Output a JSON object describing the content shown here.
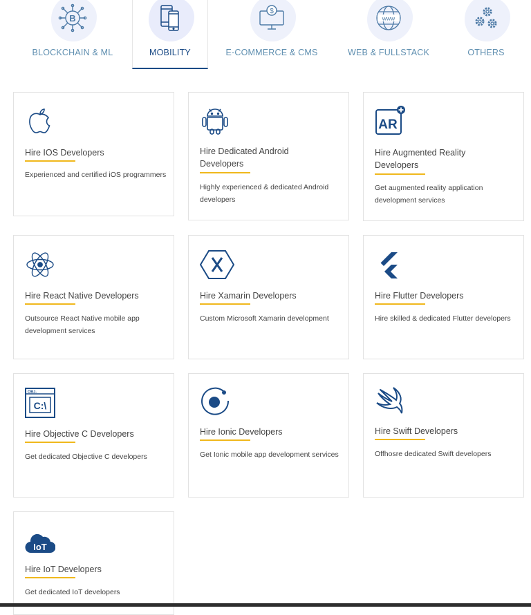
{
  "tabs": [
    {
      "label": "BLOCKCHAIN & ML",
      "icon": "bitcoin-circuit-icon",
      "active": false
    },
    {
      "label": "MOBILITY",
      "icon": "mobile-devices-icon",
      "active": true
    },
    {
      "label": "E-COMMERCE & CMS",
      "icon": "dollar-monitor-icon",
      "active": false
    },
    {
      "label": "WEB & FULLSTACK",
      "icon": "www-globe-icon",
      "active": false
    },
    {
      "label": "OTHERS",
      "icon": "gears-icon",
      "active": false
    }
  ],
  "cards": [
    {
      "title": "Hire IOS Developers",
      "desc": "Experienced and certified iOS programmers",
      "icon": "apple-icon"
    },
    {
      "title": "Hire Dedicated Android Developers",
      "desc": "Highly experienced & dedicated Android developers",
      "icon": "android-icon"
    },
    {
      "title": "Hire Augmented Reality Developers",
      "desc": "Get augmented reality application development services",
      "icon": "ar-icon"
    },
    {
      "title": "Hire React Native Developers",
      "desc": "Outsource React Native mobile app development services",
      "icon": "react-icon"
    },
    {
      "title": "Hire Xamarin Developers",
      "desc": "Custom Microsoft Xamarin development",
      "icon": "xamarin-icon"
    },
    {
      "title": "Hire Flutter Developers",
      "desc": "Hire skilled & dedicated Flutter developers",
      "icon": "flutter-icon"
    },
    {
      "title": "Hire Objective C Developers",
      "desc": "Get dedicated Objective C developers",
      "icon": "objective-c-icon"
    },
    {
      "title": "Hire Ionic Developers",
      "desc": "Get Ionic mobile app development services",
      "icon": "ionic-icon"
    },
    {
      "title": "Hire Swift Developers",
      "desc": "Offhosre dedicated Swift developers",
      "icon": "swift-icon"
    },
    {
      "title": "Hire IoT Developers",
      "desc": "Get dedicated IoT developers",
      "icon": "iot-cloud-icon"
    }
  ],
  "objc_icon_text": {
    "top": "OBJ-",
    "main": "C:\\"
  },
  "iot_icon_text": "IoT",
  "ar_icon_text": "AR",
  "colors": {
    "brand": "#1b4b86",
    "accent_underline": "#f0b81c",
    "tab_text": "#5f8fb0",
    "card_border": "#e2e2e2"
  }
}
